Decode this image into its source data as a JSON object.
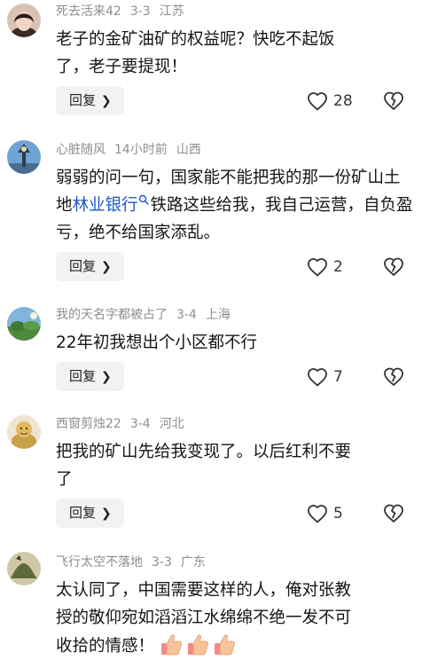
{
  "comments": [
    {
      "username": "死去活来42",
      "date": "3-3",
      "location": "江苏",
      "text_lines": [
        "老子的金矿油矿的权益呢？快吃不起饭",
        "了，老子要提现！"
      ],
      "reply_label": "回复",
      "likes": "28"
    },
    {
      "username": "心脏随风",
      "date": "14小时前",
      "location": "山西",
      "text_before_link": "弱弱的问一句，国家能不能把我的那一份矿山土地",
      "link_text": "林业银行",
      "text_after_link": "铁路这些给我，我自己运营，自负盈亏，绝不给国家添乱。",
      "reply_label": "回复",
      "likes": "2"
    },
    {
      "username": "我的天名字都被占了",
      "date": "3-4",
      "location": "上海",
      "text_lines": [
        "22年初我想出个小区都不行"
      ],
      "reply_label": "回复",
      "likes": "7"
    },
    {
      "username": "西窗剪烛22",
      "date": "3-4",
      "location": "河北",
      "text_lines": [
        "把我的矿山先给我变现了。以后红利不要",
        "了"
      ],
      "reply_label": "回复",
      "likes": "5"
    },
    {
      "username": "飞行太空不落地",
      "date": "3-3",
      "location": "广东",
      "text_lines": [
        "太认同了，中国需要这样的人，俺对张教",
        "授的敬仰宛如滔滔江水绵绵不绝一发不可",
        "收拾的情感！"
      ],
      "emoji": "thumbs-up"
    }
  ],
  "icons": {
    "like": "heart-outline-icon",
    "dislike": "broken-heart-icon",
    "link_search": "search-icon",
    "emoji": "thumbs-up-icon"
  },
  "colors": {
    "link": "#1f57c9",
    "meta": "#8e8e93",
    "reply_bg": "#f2f2f4"
  }
}
